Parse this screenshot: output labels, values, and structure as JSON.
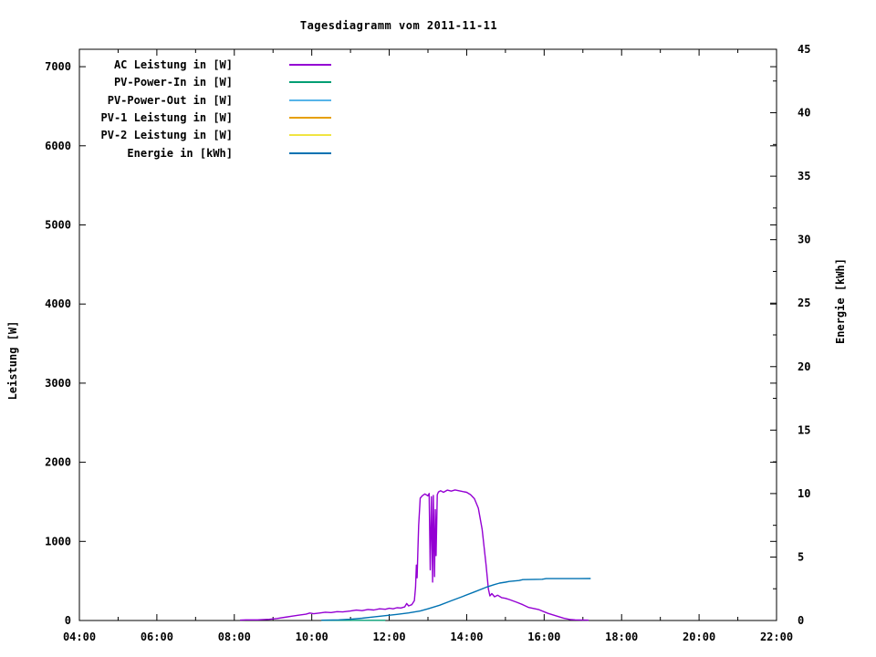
{
  "chart_data": {
    "type": "line",
    "title": "Tagesdiagramm vom 2011-11-11",
    "ylabel": "Leistung [W]",
    "y2label": "Energie [kWh]",
    "grid": false,
    "legend_position": "top-left-inside",
    "x_axis": {
      "unit": "time",
      "start_hour": 4,
      "end_hour": 22,
      "major_step_hours": 2,
      "minor_step_hours": 1,
      "tick_labels": [
        "04:00",
        "06:00",
        "08:00",
        "10:00",
        "12:00",
        "14:00",
        "16:00",
        "18:00",
        "20:00",
        "22:00"
      ]
    },
    "y_axis": {
      "min": 0,
      "max": 7220,
      "major_step": 1000,
      "tick_labels": [
        "0",
        "1000",
        "2000",
        "3000",
        "4000",
        "5000",
        "6000",
        "7000"
      ]
    },
    "y2_axis": {
      "min": 0,
      "max": 45,
      "major_step": 5,
      "minor_step": 2.5,
      "tick_labels": [
        "0",
        "5",
        "10",
        "15",
        "20",
        "25",
        "30",
        "35",
        "40",
        "45"
      ]
    },
    "legend": [
      {
        "key": "ac",
        "label": "AC Leistung in [W]",
        "color": "#9400D3"
      },
      {
        "key": "pv_in",
        "label": "PV-Power-In in [W]",
        "color": "#009E73"
      },
      {
        "key": "pv_out",
        "label": "PV-Power-Out in [W]",
        "color": "#56B4E9"
      },
      {
        "key": "pv1",
        "label": "PV-1 Leistung in [W]",
        "color": "#E69F00"
      },
      {
        "key": "pv2",
        "label": "PV-2 Leistung in [W]",
        "color": "#F0E442"
      },
      {
        "key": "energie",
        "label": "Energie in [kWh]",
        "color": "#0072B2"
      }
    ],
    "series": {
      "pv_out": {
        "name": "PV-Power-Out in [W]",
        "color": "#56B4E9",
        "axis": "left",
        "points": []
      },
      "pv1": {
        "name": "PV-1 Leistung in [W]",
        "color": "#E69F00",
        "axis": "left",
        "points": []
      },
      "pv2": {
        "name": "PV-2 Leistung in [W]",
        "color": "#F0E442",
        "axis": "left",
        "points": []
      },
      "pv_in": {
        "name": "PV-Power-In in [W]",
        "color": "#009E73",
        "axis": "left",
        "points": [
          [
            10.25,
            2
          ],
          [
            11.9,
            2
          ]
        ]
      },
      "ac": {
        "name": "AC Leistung in [W]",
        "color": "#9400D3",
        "axis": "left",
        "points": [
          [
            8.15,
            5
          ],
          [
            8.3,
            8
          ],
          [
            8.6,
            8
          ],
          [
            8.9,
            15
          ],
          [
            9.1,
            25
          ],
          [
            9.3,
            40
          ],
          [
            9.5,
            55
          ],
          [
            9.7,
            70
          ],
          [
            9.85,
            80
          ],
          [
            9.95,
            95
          ],
          [
            10.05,
            85
          ],
          [
            10.2,
            95
          ],
          [
            10.35,
            105
          ],
          [
            10.5,
            100
          ],
          [
            10.65,
            112
          ],
          [
            10.8,
            108
          ],
          [
            11.0,
            120
          ],
          [
            11.15,
            132
          ],
          [
            11.3,
            125
          ],
          [
            11.45,
            140
          ],
          [
            11.6,
            133
          ],
          [
            11.75,
            148
          ],
          [
            11.9,
            142
          ],
          [
            12.0,
            155
          ],
          [
            12.1,
            148
          ],
          [
            12.2,
            162
          ],
          [
            12.3,
            158
          ],
          [
            12.4,
            172
          ],
          [
            12.45,
            215
          ],
          [
            12.5,
            185
          ],
          [
            12.58,
            200
          ],
          [
            12.65,
            250
          ],
          [
            12.68,
            420
          ],
          [
            12.7,
            700
          ],
          [
            12.72,
            540
          ],
          [
            12.74,
            900
          ],
          [
            12.76,
            1200
          ],
          [
            12.8,
            1545
          ],
          [
            12.85,
            1575
          ],
          [
            12.92,
            1600
          ],
          [
            13.0,
            1575
          ],
          [
            13.03,
            1605
          ],
          [
            13.06,
            640
          ],
          [
            13.09,
            1565
          ],
          [
            13.12,
            485
          ],
          [
            13.14,
            1580
          ],
          [
            13.17,
            555
          ],
          [
            13.19,
            1400
          ],
          [
            13.21,
            820
          ],
          [
            13.24,
            1590
          ],
          [
            13.27,
            1625
          ],
          [
            13.33,
            1640
          ],
          [
            13.4,
            1620
          ],
          [
            13.5,
            1648
          ],
          [
            13.6,
            1635
          ],
          [
            13.7,
            1650
          ],
          [
            13.8,
            1640
          ],
          [
            13.9,
            1630
          ],
          [
            14.0,
            1620
          ],
          [
            14.1,
            1590
          ],
          [
            14.2,
            1540
          ],
          [
            14.3,
            1420
          ],
          [
            14.4,
            1150
          ],
          [
            14.5,
            700
          ],
          [
            14.56,
            400
          ],
          [
            14.6,
            310
          ],
          [
            14.65,
            340
          ],
          [
            14.72,
            300
          ],
          [
            14.8,
            320
          ],
          [
            14.9,
            290
          ],
          [
            15.0,
            280
          ],
          [
            15.1,
            265
          ],
          [
            15.3,
            230
          ],
          [
            15.45,
            200
          ],
          [
            15.6,
            165
          ],
          [
            15.85,
            140
          ],
          [
            16.1,
            90
          ],
          [
            16.3,
            60
          ],
          [
            16.5,
            30
          ],
          [
            16.68,
            12
          ],
          [
            16.8,
            8
          ],
          [
            17.1,
            5
          ],
          [
            17.15,
            3
          ]
        ]
      },
      "energie": {
        "name": "Energie in [kWh]",
        "color": "#0072B2",
        "axis": "right",
        "points": [
          [
            10.25,
            0.02
          ],
          [
            10.7,
            0.05
          ],
          [
            11.0,
            0.1
          ],
          [
            11.3,
            0.18
          ],
          [
            11.6,
            0.28
          ],
          [
            11.9,
            0.38
          ],
          [
            12.2,
            0.48
          ],
          [
            12.5,
            0.6
          ],
          [
            12.8,
            0.75
          ],
          [
            13.0,
            0.92
          ],
          [
            13.3,
            1.2
          ],
          [
            13.6,
            1.55
          ],
          [
            13.9,
            1.9
          ],
          [
            14.2,
            2.25
          ],
          [
            14.5,
            2.62
          ],
          [
            14.7,
            2.82
          ],
          [
            14.85,
            2.95
          ],
          [
            15.0,
            3.02
          ],
          [
            15.1,
            3.08
          ],
          [
            15.35,
            3.15
          ],
          [
            15.45,
            3.22
          ],
          [
            15.95,
            3.25
          ],
          [
            16.05,
            3.3
          ],
          [
            17.2,
            3.31
          ]
        ]
      }
    }
  }
}
